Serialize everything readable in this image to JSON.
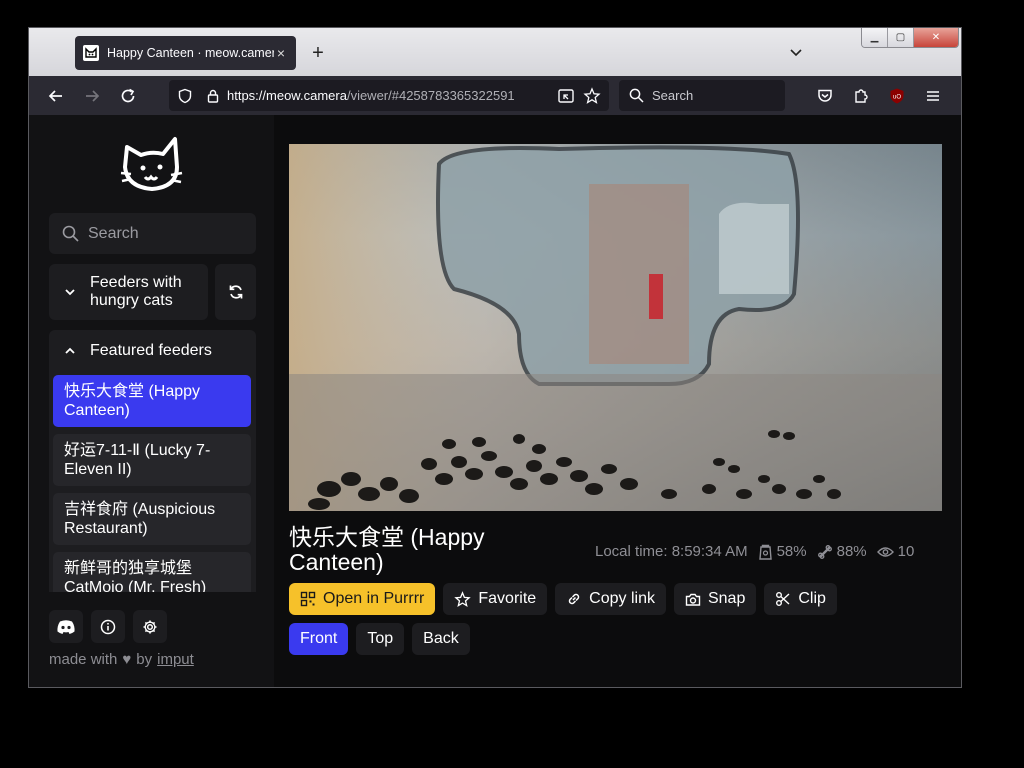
{
  "browser": {
    "tab_title": "Happy Canteen · meow.camera",
    "url_main": "https://meow.camera",
    "url_rest": "/viewer/#4258783365322591",
    "search_placeholder": "Search"
  },
  "sidebar": {
    "search_placeholder": "Search",
    "filter_label": "Feeders with hungry cats",
    "featured_label": "Featured feeders",
    "feeders": [
      {
        "label": "快乐大食堂 (Happy Canteen)",
        "active": true
      },
      {
        "label": "好运7-11-Ⅱ (Lucky 7-Eleven II)",
        "active": false
      },
      {
        "label": "吉祥食府 (Auspicious Restaurant)",
        "active": false
      },
      {
        "label": "新鲜哥的独享城堡 CatMojo (Mr. Fresh)",
        "active": false
      }
    ],
    "made_with_prefix": "made with",
    "made_with_by": "by",
    "made_with_link": "imput"
  },
  "camera": {
    "title": "快乐大食堂 (Happy Canteen)",
    "local_time": "Local time: 8:59:34 AM",
    "food_level": "58%",
    "battery": "88%",
    "viewers": "10"
  },
  "actions": {
    "open_label": "Open in Purrrr",
    "favorite_label": "Favorite",
    "copy_label": "Copy link",
    "snap_label": "Snap",
    "clip_label": "Clip"
  },
  "views": {
    "front": "Front",
    "top": "Top",
    "back": "Back",
    "active": "Front"
  },
  "colors": {
    "accent": "#3a3aef",
    "primary_button": "#f6c12a",
    "sidebar_bg": "#121214"
  }
}
